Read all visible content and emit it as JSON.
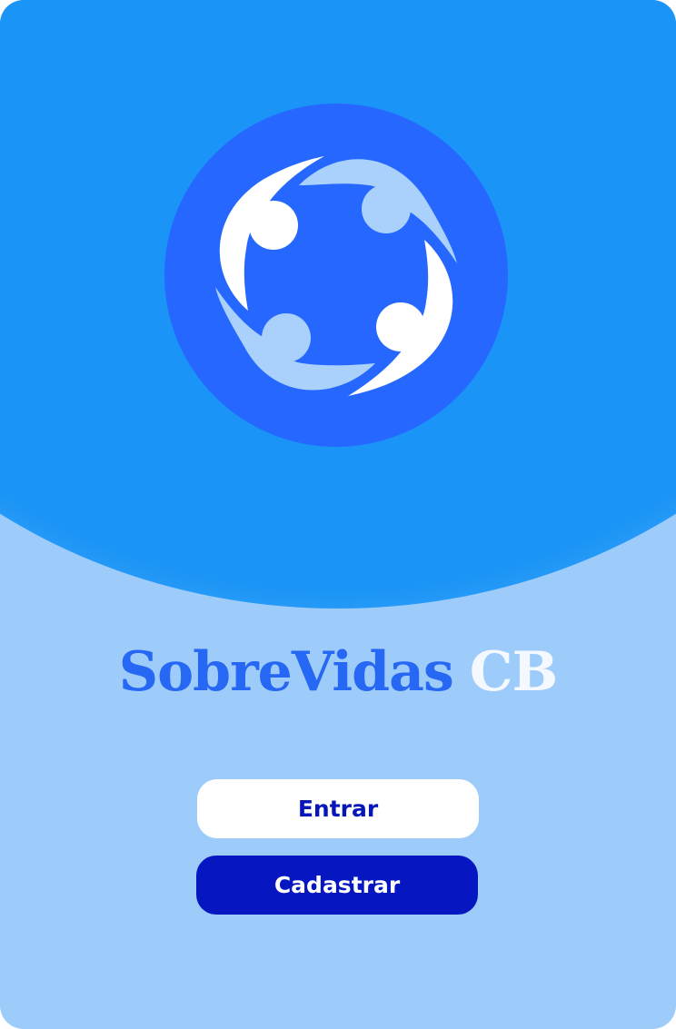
{
  "app": {
    "name": "SobreVidas",
    "suffix": "CB"
  },
  "logo": {
    "icon": "community-circle-icon",
    "colors": {
      "circle": "#2667ff",
      "figure_light": "#a9d1fb",
      "figure_white": "#ffffff"
    }
  },
  "actions": {
    "login_label": "Entrar",
    "signup_label": "Cadastrar"
  },
  "theme": {
    "background_top": "#1a94f6",
    "background_bottom": "#9dcbfa",
    "title_color": "#2667f3",
    "primary_button": "#0616c0",
    "secondary_button": "#ffffff"
  }
}
